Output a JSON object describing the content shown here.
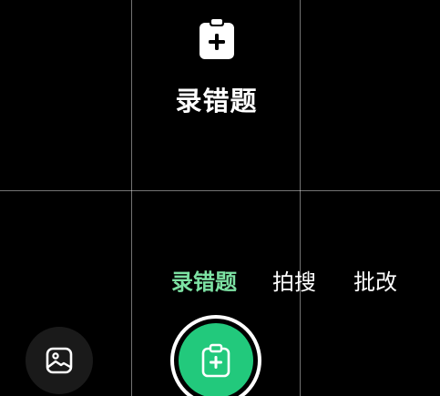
{
  "hero": {
    "icon": "clipboard-plus-icon",
    "title": "录错题"
  },
  "tabs": [
    {
      "label": "录错题",
      "active": true
    },
    {
      "label": "拍搜",
      "active": false
    },
    {
      "label": "批改",
      "active": false
    }
  ],
  "controls": {
    "gallery_icon": "image-icon",
    "shutter_icon": "clipboard-plus-icon"
  },
  "colors": {
    "background": "#000000",
    "accent": "#22c97c",
    "active_tab": "#7de2a3",
    "text": "#ffffff"
  }
}
